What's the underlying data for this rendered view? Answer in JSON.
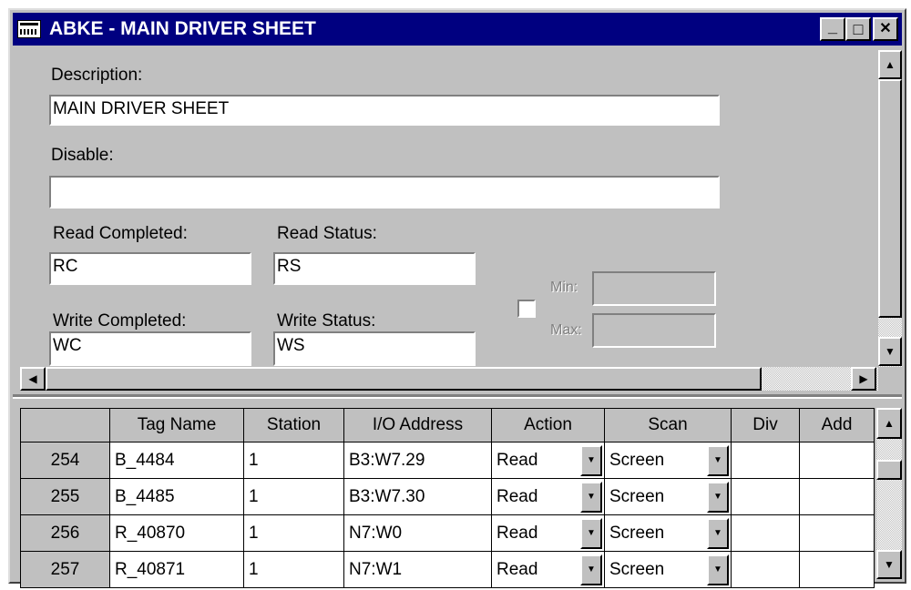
{
  "window": {
    "title": "ABKE - MAIN DRIVER SHEET",
    "minimize_glyph": "_",
    "maximize_glyph": "□",
    "close_glyph": "✕"
  },
  "form": {
    "description_label": "Description:",
    "description_value": "MAIN DRIVER SHEET",
    "disable_label": "Disable:",
    "disable_value": "",
    "read_completed_label": "Read Completed:",
    "read_completed_value": "RC",
    "read_status_label": "Read Status:",
    "read_status_value": "RS",
    "write_completed_label": "Write Completed:",
    "write_completed_value": "WC",
    "write_status_label": "Write Status:",
    "write_status_value": "WS",
    "min_label": "Min:",
    "min_value": "",
    "max_label": "Max:",
    "max_value": "",
    "range_checkbox_checked": false
  },
  "grid": {
    "columns": [
      "",
      "Tag Name",
      "Station",
      "I/O Address",
      "Action",
      "Scan",
      "Div",
      "Add"
    ],
    "rows": [
      {
        "num": "254",
        "tag": "B_4484",
        "station": "1",
        "address": "B3:W7.29",
        "action": "Read",
        "scan": "Screen",
        "div": "",
        "add": ""
      },
      {
        "num": "255",
        "tag": "B_4485",
        "station": "1",
        "address": "B3:W7.30",
        "action": "Read",
        "scan": "Screen",
        "div": "",
        "add": ""
      },
      {
        "num": "256",
        "tag": "R_40870",
        "station": "1",
        "address": "N7:W0",
        "action": "Read",
        "scan": "Screen",
        "div": "",
        "add": ""
      },
      {
        "num": "257",
        "tag": "R_40871",
        "station": "1",
        "address": "N7:W1",
        "action": "Read",
        "scan": "Screen",
        "div": "",
        "add": ""
      }
    ]
  },
  "icons": {
    "up": "▲",
    "down": "▼",
    "left": "◀",
    "right": "▶",
    "dropdown": "▼"
  }
}
